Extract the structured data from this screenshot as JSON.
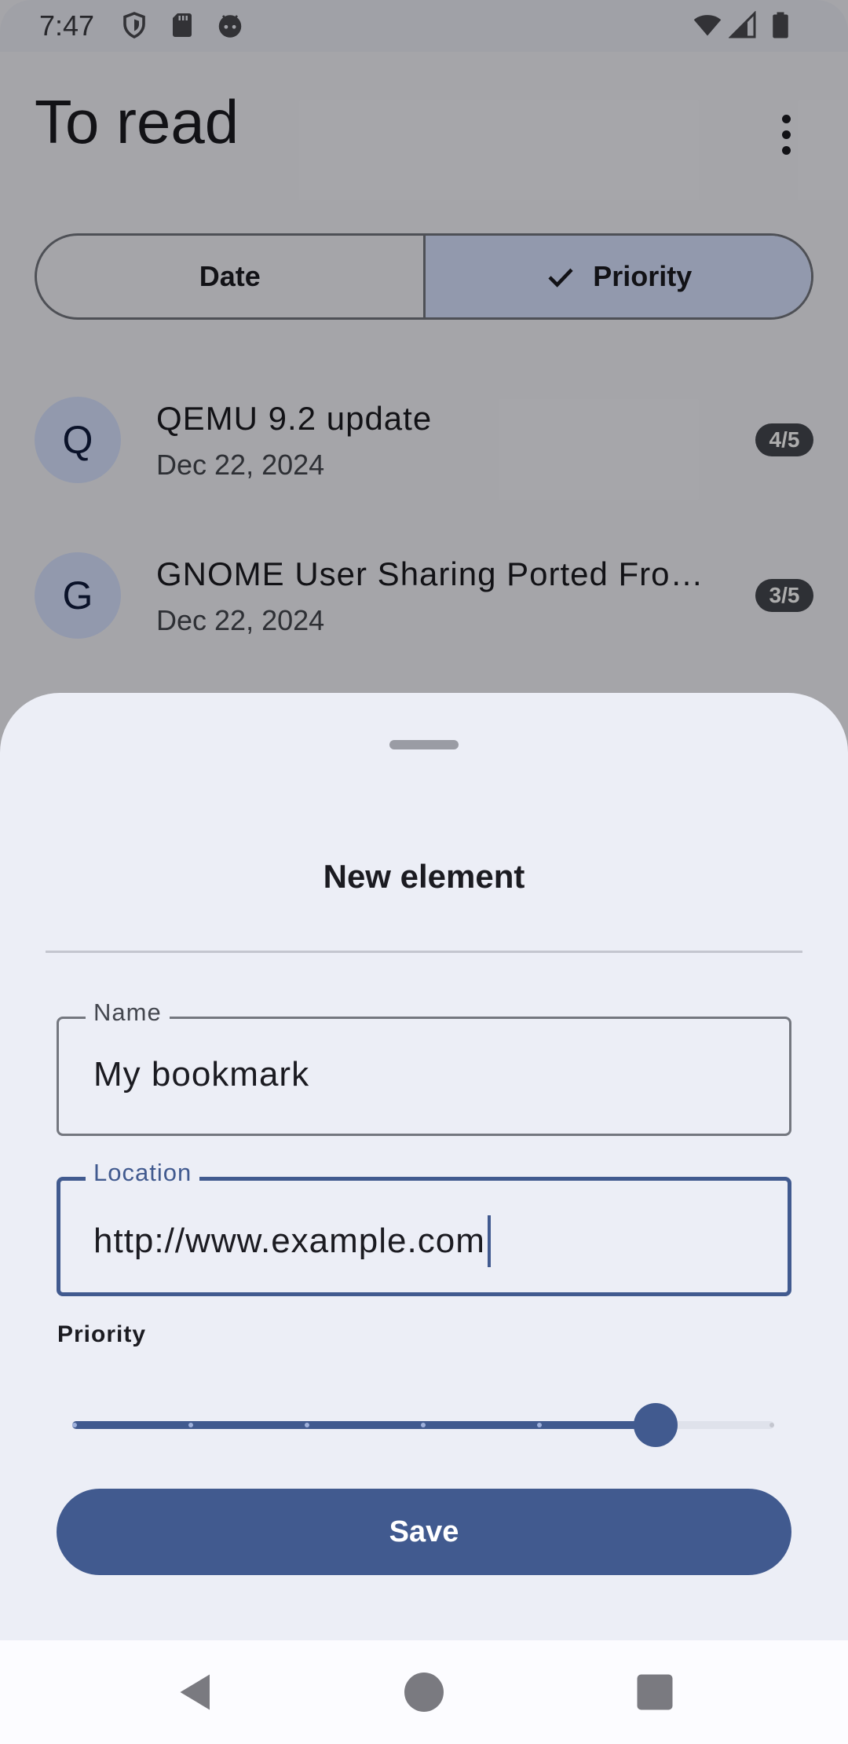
{
  "status_bar": {
    "time": "7:47",
    "left_icons": [
      "shield-icon",
      "sd-card-icon",
      "android-debug-icon"
    ],
    "right_icons": [
      "wifi-icon",
      "cell-signal-icon",
      "battery-icon"
    ]
  },
  "screen": {
    "title": "To read",
    "sort_options": [
      {
        "label": "Date",
        "selected": false
      },
      {
        "label": "Priority",
        "selected": true
      }
    ],
    "items": [
      {
        "initial": "Q",
        "title": "QEMU 9.2 update",
        "date": "Dec 22, 2024",
        "priority": "4/5"
      },
      {
        "initial": "G",
        "title": "GNOME User Sharing Ported Fro…",
        "date": "Dec 22, 2024",
        "priority": "3/5"
      }
    ]
  },
  "sheet": {
    "title": "New element",
    "name_field": {
      "label": "Name",
      "value": "My bookmark"
    },
    "location_field": {
      "label": "Location",
      "value": "http://www.example.com"
    },
    "priority": {
      "label": "Priority",
      "value": 5,
      "min": 0,
      "max": 6,
      "steps": 7
    },
    "save_label": "Save"
  },
  "nav_bar": {
    "buttons": [
      "back",
      "home",
      "recents"
    ]
  },
  "colors": {
    "primary": "#415a8f",
    "primary_container": "#d8e2ff",
    "surface": "#eceef6",
    "background": "#f4f4fa"
  }
}
